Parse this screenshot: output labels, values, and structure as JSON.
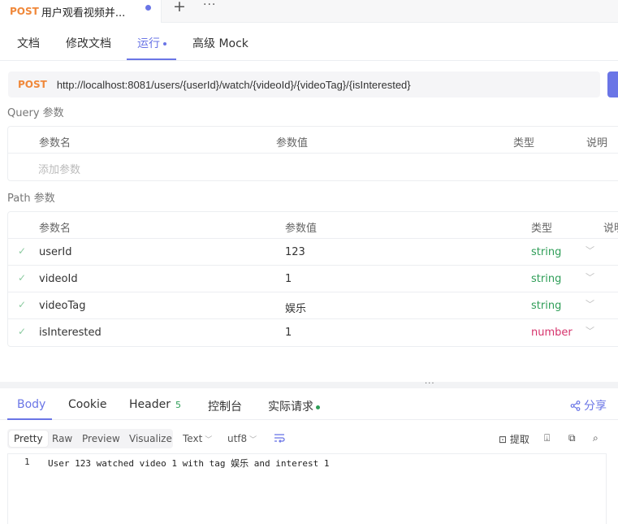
{
  "tab": {
    "method": "POST",
    "title": "用户观看视频并..."
  },
  "subtabs": [
    {
      "label": "文档"
    },
    {
      "label": "修改文档"
    },
    {
      "label": "运行"
    },
    {
      "label": "高级 Mock"
    }
  ],
  "request": {
    "method": "POST",
    "url": "http://localhost:8081/users/{userId}/watch/{videoId}/{videoTag}/{isInterested}"
  },
  "query": {
    "title": "Query 参数",
    "headers": [
      "参数名",
      "参数值",
      "类型",
      "说明"
    ],
    "add_placeholder": "添加参数"
  },
  "path": {
    "title": "Path 参数",
    "headers": [
      "参数名",
      "参数值",
      "类型",
      "说明"
    ],
    "rows": [
      {
        "name": "userId",
        "value": "123",
        "type": "string"
      },
      {
        "name": "videoId",
        "value": "1",
        "type": "string"
      },
      {
        "name": "videoTag",
        "value": "娱乐",
        "type": "string"
      },
      {
        "name": "isInterested",
        "value": "1",
        "type": "number"
      }
    ]
  },
  "response": {
    "tabs": {
      "body": "Body",
      "cookie": "Cookie",
      "header": "Header",
      "header_count": "5",
      "console": "控制台",
      "actual": "实际请求"
    },
    "share": "分享",
    "views": [
      "Pretty",
      "Raw",
      "Preview",
      "Visualize"
    ],
    "format": "Text",
    "encoding": "utf8",
    "extract": "提取",
    "line_number": "1",
    "body_text": "User 123 watched video 1 with tag 娱乐 and interest 1"
  },
  "colors": {
    "accent": "#6a75e6",
    "method_post": "#f0883a",
    "type_string": "#2e9d57",
    "type_number": "#d6336c"
  }
}
